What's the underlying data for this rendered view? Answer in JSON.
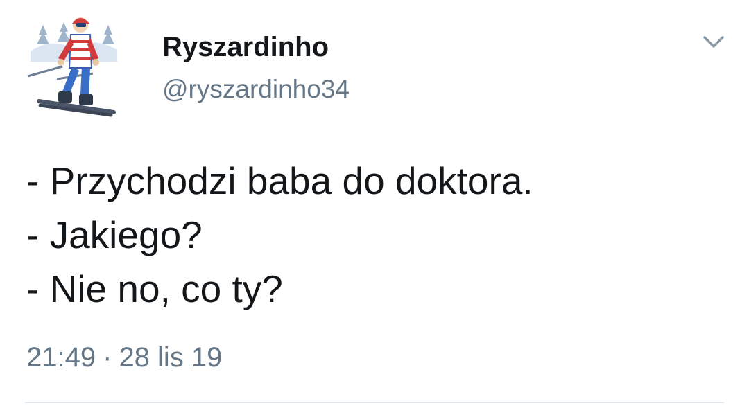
{
  "tweet": {
    "author": {
      "display_name": "Ryszardinho",
      "handle": "@ryszardinho34",
      "avatar_icon": "skier-avatar-icon"
    },
    "menu_icon": "chevron-down-icon",
    "lines": [
      "- Przychodzi baba do doktora.",
      "- Jakiego?",
      "- Nie no, co ty?"
    ],
    "time": "21:49",
    "separator": "·",
    "date": "28 lis 19"
  },
  "colors": {
    "text": "#14171a",
    "secondary": "#657786",
    "divider": "#e1e8ed"
  }
}
